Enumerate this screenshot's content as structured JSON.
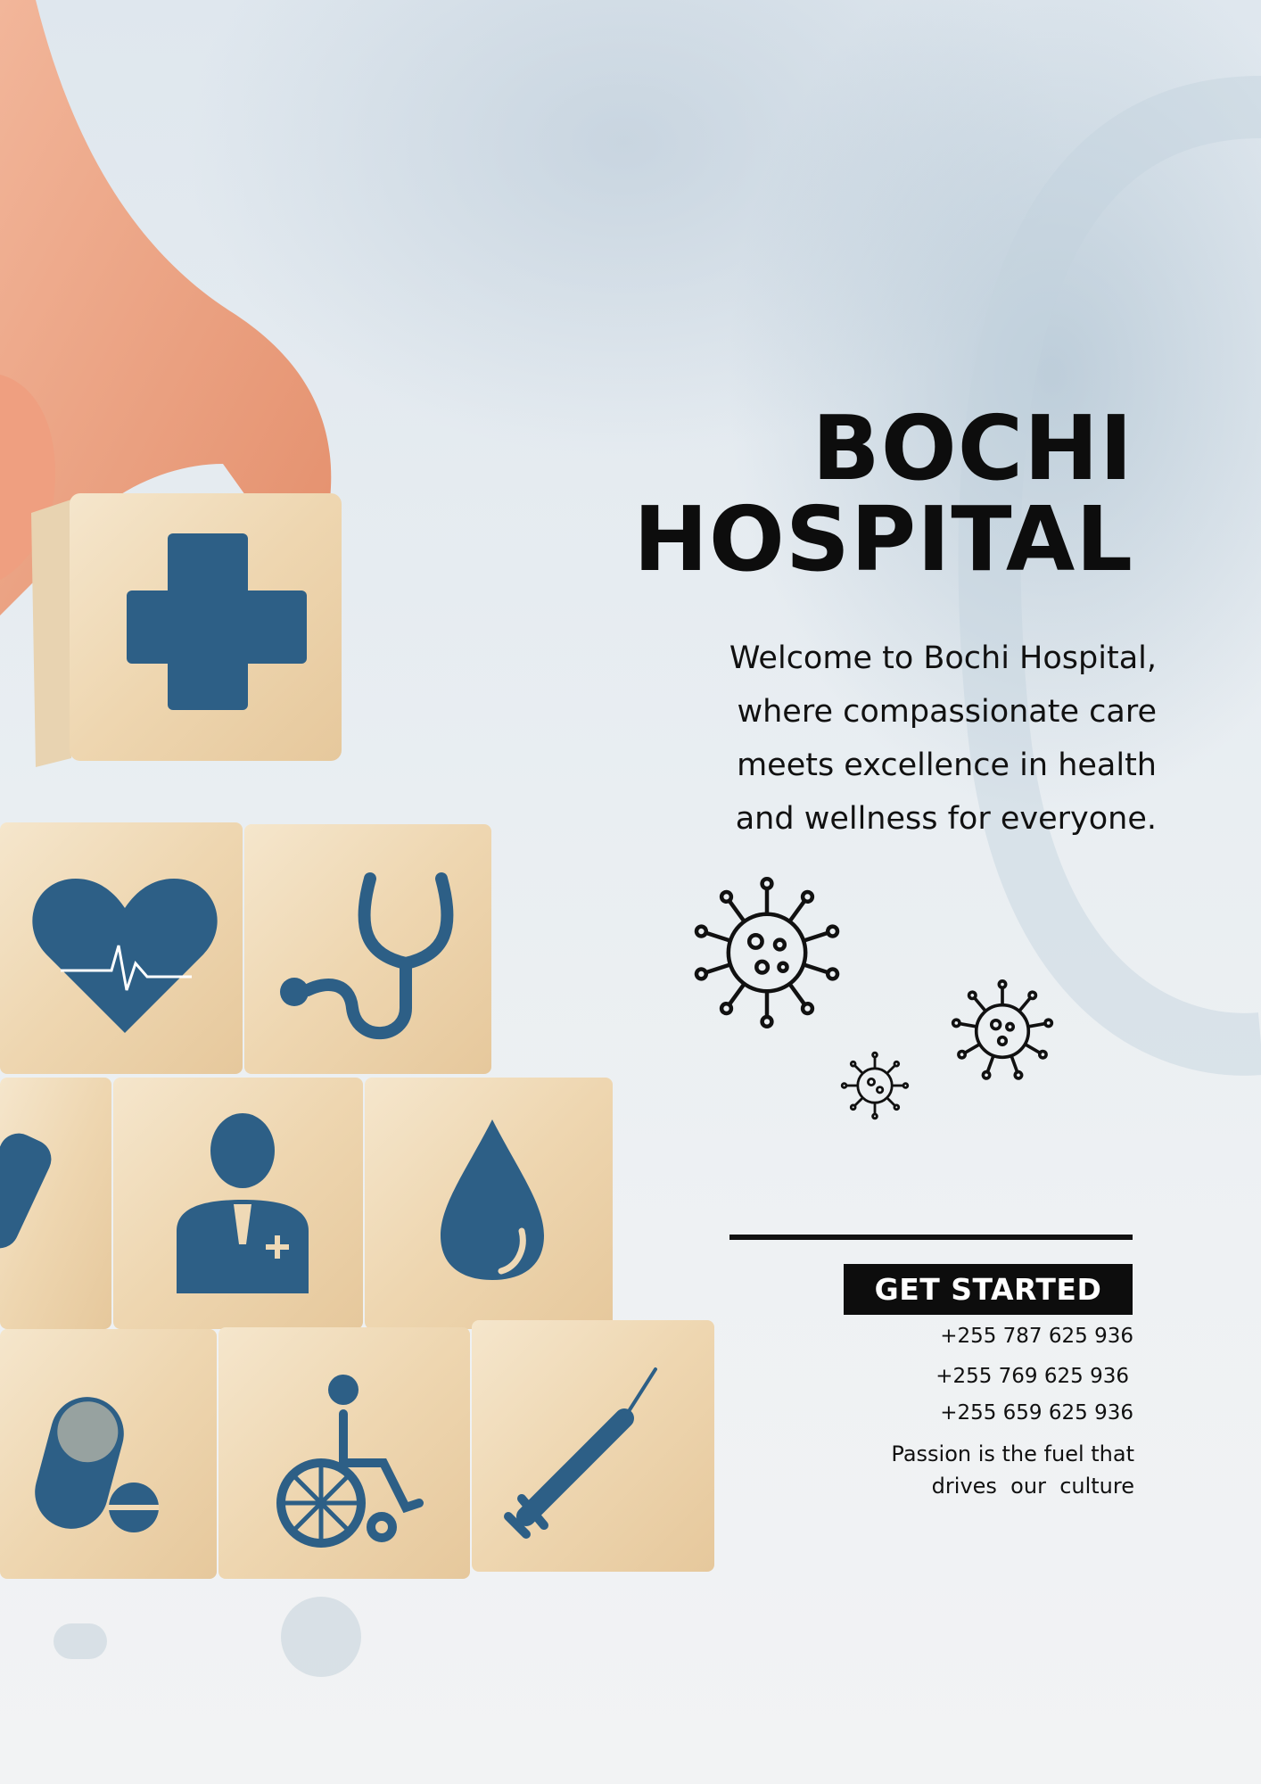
{
  "hospital": {
    "title_line1": "BOCHI",
    "title_line2": "HOSPITAL",
    "intro_lines": [
      "Welcome to Bochi Hospital,",
      "where compassionate care",
      "meets excellence in health",
      "and wellness for everyone."
    ]
  },
  "cta": {
    "label": "GET STARTED"
  },
  "contact": {
    "phones": [
      "+255 787 625 936",
      "+255 769 625 936",
      "+255 659 625 936"
    ]
  },
  "tagline": {
    "line1": "Passion is the fuel that",
    "line2": "drives  our  culture"
  },
  "colors": {
    "icon_blue": "#2d5f86",
    "wood": "#efd9b6",
    "text": "#111111"
  },
  "icons": [
    "plus-icon",
    "heart-rate-icon",
    "stethoscope-icon",
    "bandage-icon",
    "doctor-icon",
    "blood-drop-icon",
    "pill-icon",
    "wheelchair-icon",
    "syringe-icon",
    "virus-icon"
  ]
}
